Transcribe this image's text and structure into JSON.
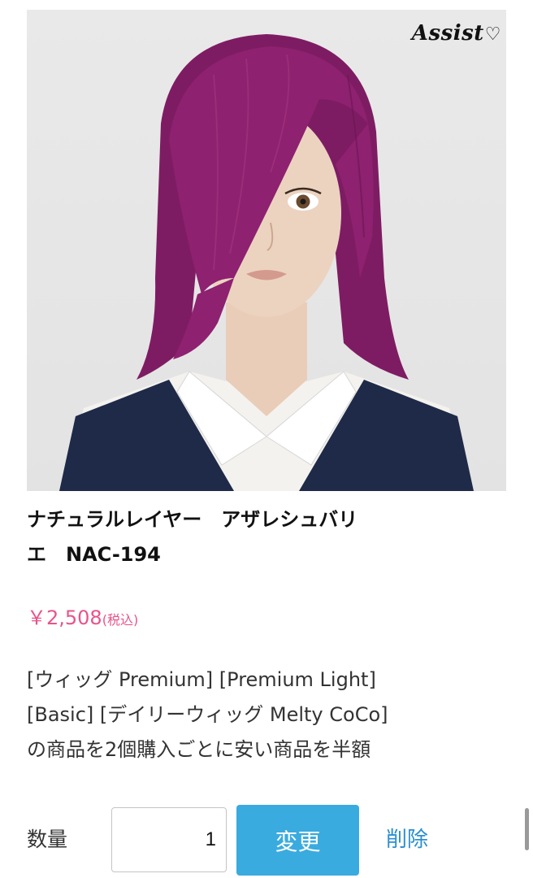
{
  "product": {
    "brand_logo": "Assist",
    "title_line1": "ナチュラルレイヤー　アザレシュバリ",
    "title_line2": "エ　NAC-194",
    "price": "￥2,508",
    "price_tax": "(税込)",
    "promo_line1": "[ウィッグ Premium] [Premium Light]",
    "promo_line2": "[Basic] [デイリーウィッグ Melty CoCo]",
    "promo_line3": "の商品を2個購入ごとに安い商品を半額"
  },
  "cart": {
    "quantity_label": "数量",
    "quantity_value": "1",
    "change_label": "変更",
    "delete_label": "削除"
  },
  "colors": {
    "hair": "#8e2170",
    "price": "#e8548a",
    "button": "#3aabdf",
    "link": "#2d8fd0"
  }
}
